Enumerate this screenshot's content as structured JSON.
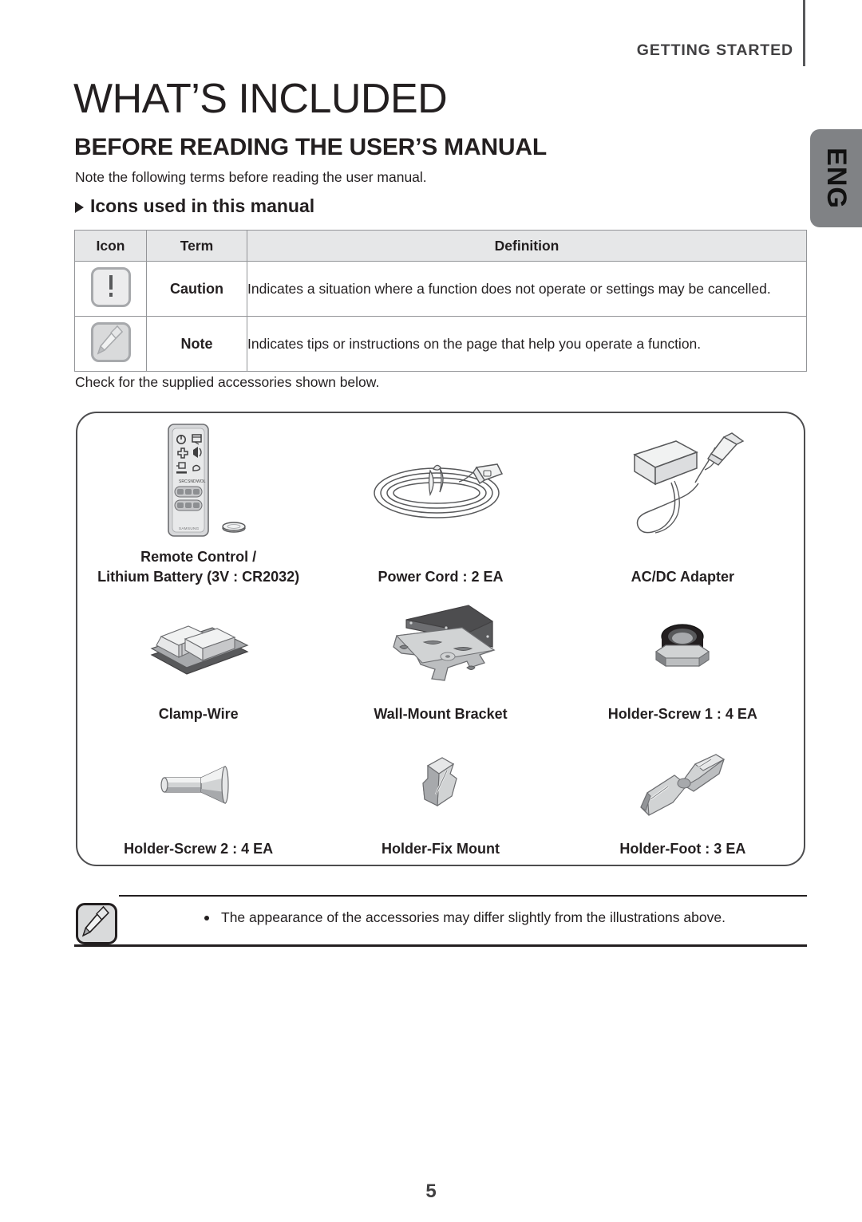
{
  "header": {
    "section_label": "GETTING STARTED",
    "side_tab": "ENG"
  },
  "titles": {
    "page_title": "WHAT’S INCLUDED",
    "subtitle": "BEFORE READING THE USER’S MANUAL",
    "intro": "Note the following terms before reading the user manual.",
    "icons_heading": "Icons used in this manual"
  },
  "icon_table": {
    "headers": [
      "Icon",
      "Term",
      "Definition"
    ],
    "rows": [
      {
        "icon": "caution-icon",
        "term": "Caution",
        "definition": "Indicates a situation where a function does not operate or settings may be cancelled."
      },
      {
        "icon": "note-icon",
        "term": "Note",
        "definition": "Indicates tips or instructions on the page that help you operate a function."
      }
    ]
  },
  "check_text": "Check for the supplied accessories shown below.",
  "accessories": [
    {
      "art": "remote-control-art",
      "label": "Remote Control /\nLithium Battery (3V : CR2032)"
    },
    {
      "art": "power-cord-art",
      "label": "Power Cord : 2 EA"
    },
    {
      "art": "ac-dc-adapter-art",
      "label": "AC/DC Adapter"
    },
    {
      "art": "clamp-wire-art",
      "label": "Clamp-Wire"
    },
    {
      "art": "wall-mount-bracket-art",
      "label": "Wall-Mount Bracket"
    },
    {
      "art": "holder-screw-1-art",
      "label": "Holder-Screw 1 : 4 EA"
    },
    {
      "art": "holder-screw-2-art",
      "label": "Holder-Screw 2 : 4 EA"
    },
    {
      "art": "holder-fix-mount-art",
      "label": "Holder-Fix Mount"
    },
    {
      "art": "holder-foot-art",
      "label": "Holder-Foot : 3 EA"
    }
  ],
  "footer_note": {
    "icon": "note-icon",
    "text": "The appearance of the accessories may differ slightly from the illustrations above."
  },
  "page_number": "5",
  "colors": {
    "text": "#231f20",
    "tab_gray": "#808285",
    "table_header_bg": "#e6e7e8",
    "table_border": "#939598",
    "box_border": "#4d4d4f"
  }
}
